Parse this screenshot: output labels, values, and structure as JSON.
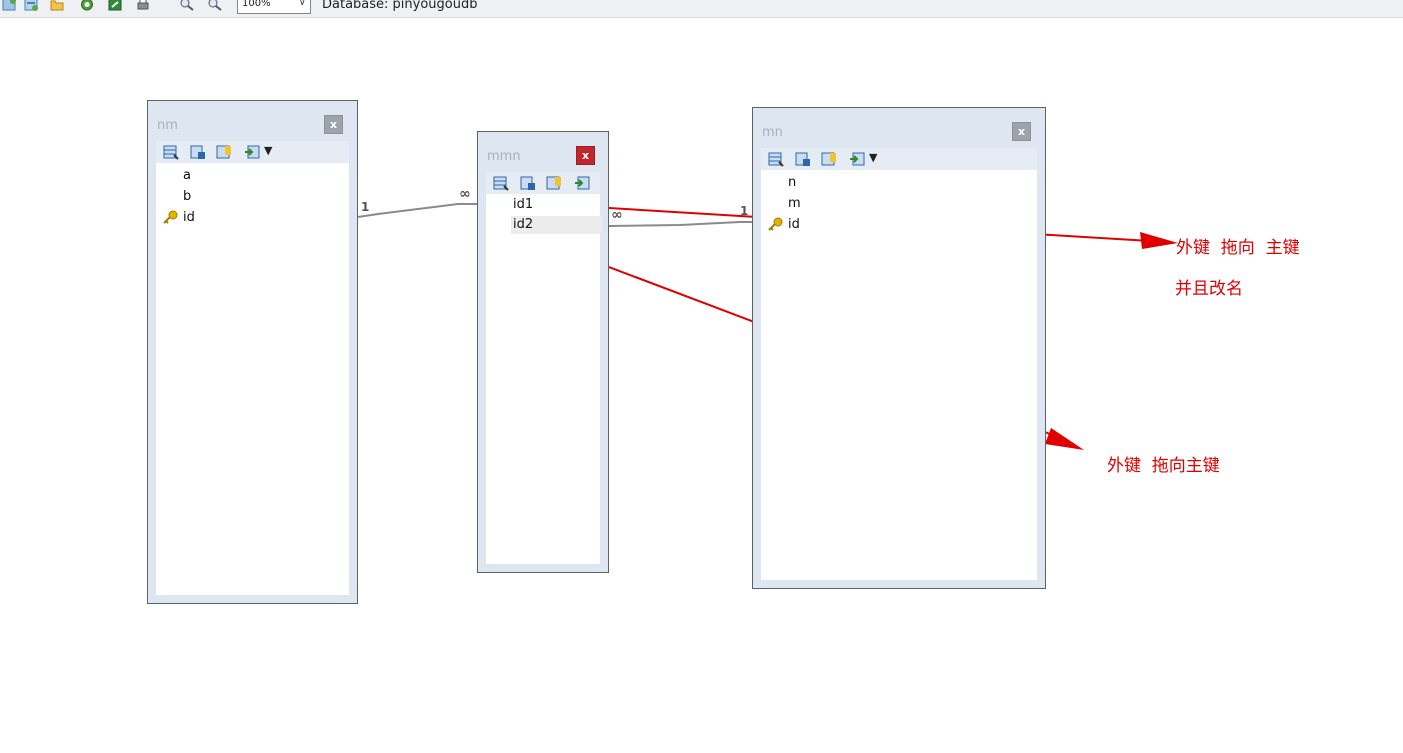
{
  "toolbar": {
    "icons": [
      "new-table-icon",
      "add-view-icon",
      "open-folder-icon",
      "refresh-icon",
      "export-icon",
      "print-icon",
      "zoom-in-icon",
      "zoom-out-icon"
    ],
    "zoom_value": "100%",
    "database_label": "Database: pinyougoudb"
  },
  "tables": {
    "nm": {
      "title": "nm",
      "close": "x",
      "fields": [
        "a",
        "b",
        "id"
      ],
      "primary_key": "id"
    },
    "mmn": {
      "title": "mmn",
      "close": "x",
      "fields": [
        "id1",
        "id2"
      ],
      "selected_field": "id2"
    },
    "mn": {
      "title": "mn",
      "close": "x",
      "fields": [
        "n",
        "m",
        "id"
      ],
      "primary_key": "id"
    }
  },
  "relations": [
    {
      "from": "nm.id",
      "to": "mmn.id1",
      "one_label": "1",
      "many_label": "∞"
    },
    {
      "from": "mmn.id2",
      "to": "mn.id",
      "one_label": "1",
      "many_label": "∞"
    }
  ],
  "annotations": {
    "note1_line1": "外键  拖向  主键",
    "note1_line2": "并且改名",
    "note2": "外键  拖向主键",
    "color": "#e00000"
  },
  "colors": {
    "widget_bg": "#dde6f1",
    "close_active": "#c0262d",
    "close_inactive": "#9ca3ad",
    "relation_line": "#8a8a8a"
  }
}
